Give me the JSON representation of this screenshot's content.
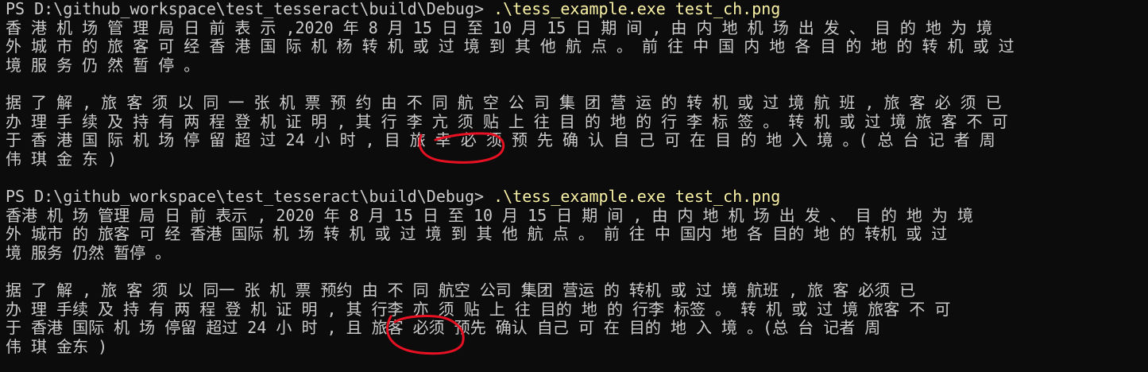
{
  "theme": {
    "background": "#0c0c0c",
    "foreground": "#cccccc",
    "command_color": "#f9f1a5",
    "annotation_color": "#e81123"
  },
  "runs": [
    {
      "prompt": "PS D:\\github_workspace\\test_tesseract\\build\\Debug> ",
      "command": ".\\tess_example.exe test_ch.png",
      "output": [
        "香 港 机 场 管 理 局 日 前 表 示 ,2020 年 8 月 15 日 至 10 月 15 日 期 间 , 由 内 地 机 场 出 发 、 目 的 地 为 境",
        "外 城 市 的 旅 客 可 经 香 港 国 际 机 杨 转 机 或 过 境 到 其 他 航 点 。 前 往 中 国 内 地 各 目 的 地 的 转 机 或 过",
        "境 服 务 仍 然 暂 停 。",
        "",
        "据 了 解 , 旅 客 须 以 同 一 张 机 票 预 约 由 不 同 航 空 公 司 集 团 营 运 的 转 机 或 过 境 航 班 , 旅 客 必 须 已",
        "办 理 手 续 及 持 有 两 程 登 机 证 明 , 其 行 李 亢 须 贴 上 往 目 的 地 的 行 李 标 签 。 转 机 或 过 境 旅 客 不 可",
        "于 香 港 国 际 机 场 停 留 超 过 24 小 时 , 目 旅 幸 必 须 预 先 确 认 自 己 可 在 目 的 地 入 境 。( 总 台 记 者 周",
        "伟 琪 金 东 )",
        ""
      ]
    },
    {
      "prompt": "PS D:\\github_workspace\\test_tesseract\\build\\Debug> ",
      "command": ".\\tess_example.exe test_ch.png",
      "output": [
        "香港 机 场 管理 局 日 前 表示 , 2020 年 8 月 15 日 至 10 月 15 日 期 间 , 由 内 地 机 场 出 发 、 目 的 地 为 境",
        "外 城市 的 旅客 可 经 香港 国际 机 场 转 机 或 过 境 到 其 他 航 点 。 前 往 中 国内 地 各 目的 地 的 转机 或 过",
        "境 服务 仍然 暂停 。",
        "",
        "据 了 解 , 旅 客 须 以 同一 张 机 票 预约 由 不 同 航空 公司 集团 营运 的 转机 或 过 境 航班 , 旅 客 必须 已",
        "办 理 手续 及 持 有 两 程 登 机 证 明 , 其 行李 亦 须 贴 上 往 目的 地 的 行李 标签 。 转 机 或 过 境 旅客 不 可",
        "于 香港 国际 机 场 停留 超过 24 小 时 , 且 旅客 必须 预先 确认 自己 可 在 目的 地 入 境 。(总 台 记者 周",
        "伟 琪 金东 )"
      ]
    }
  ]
}
